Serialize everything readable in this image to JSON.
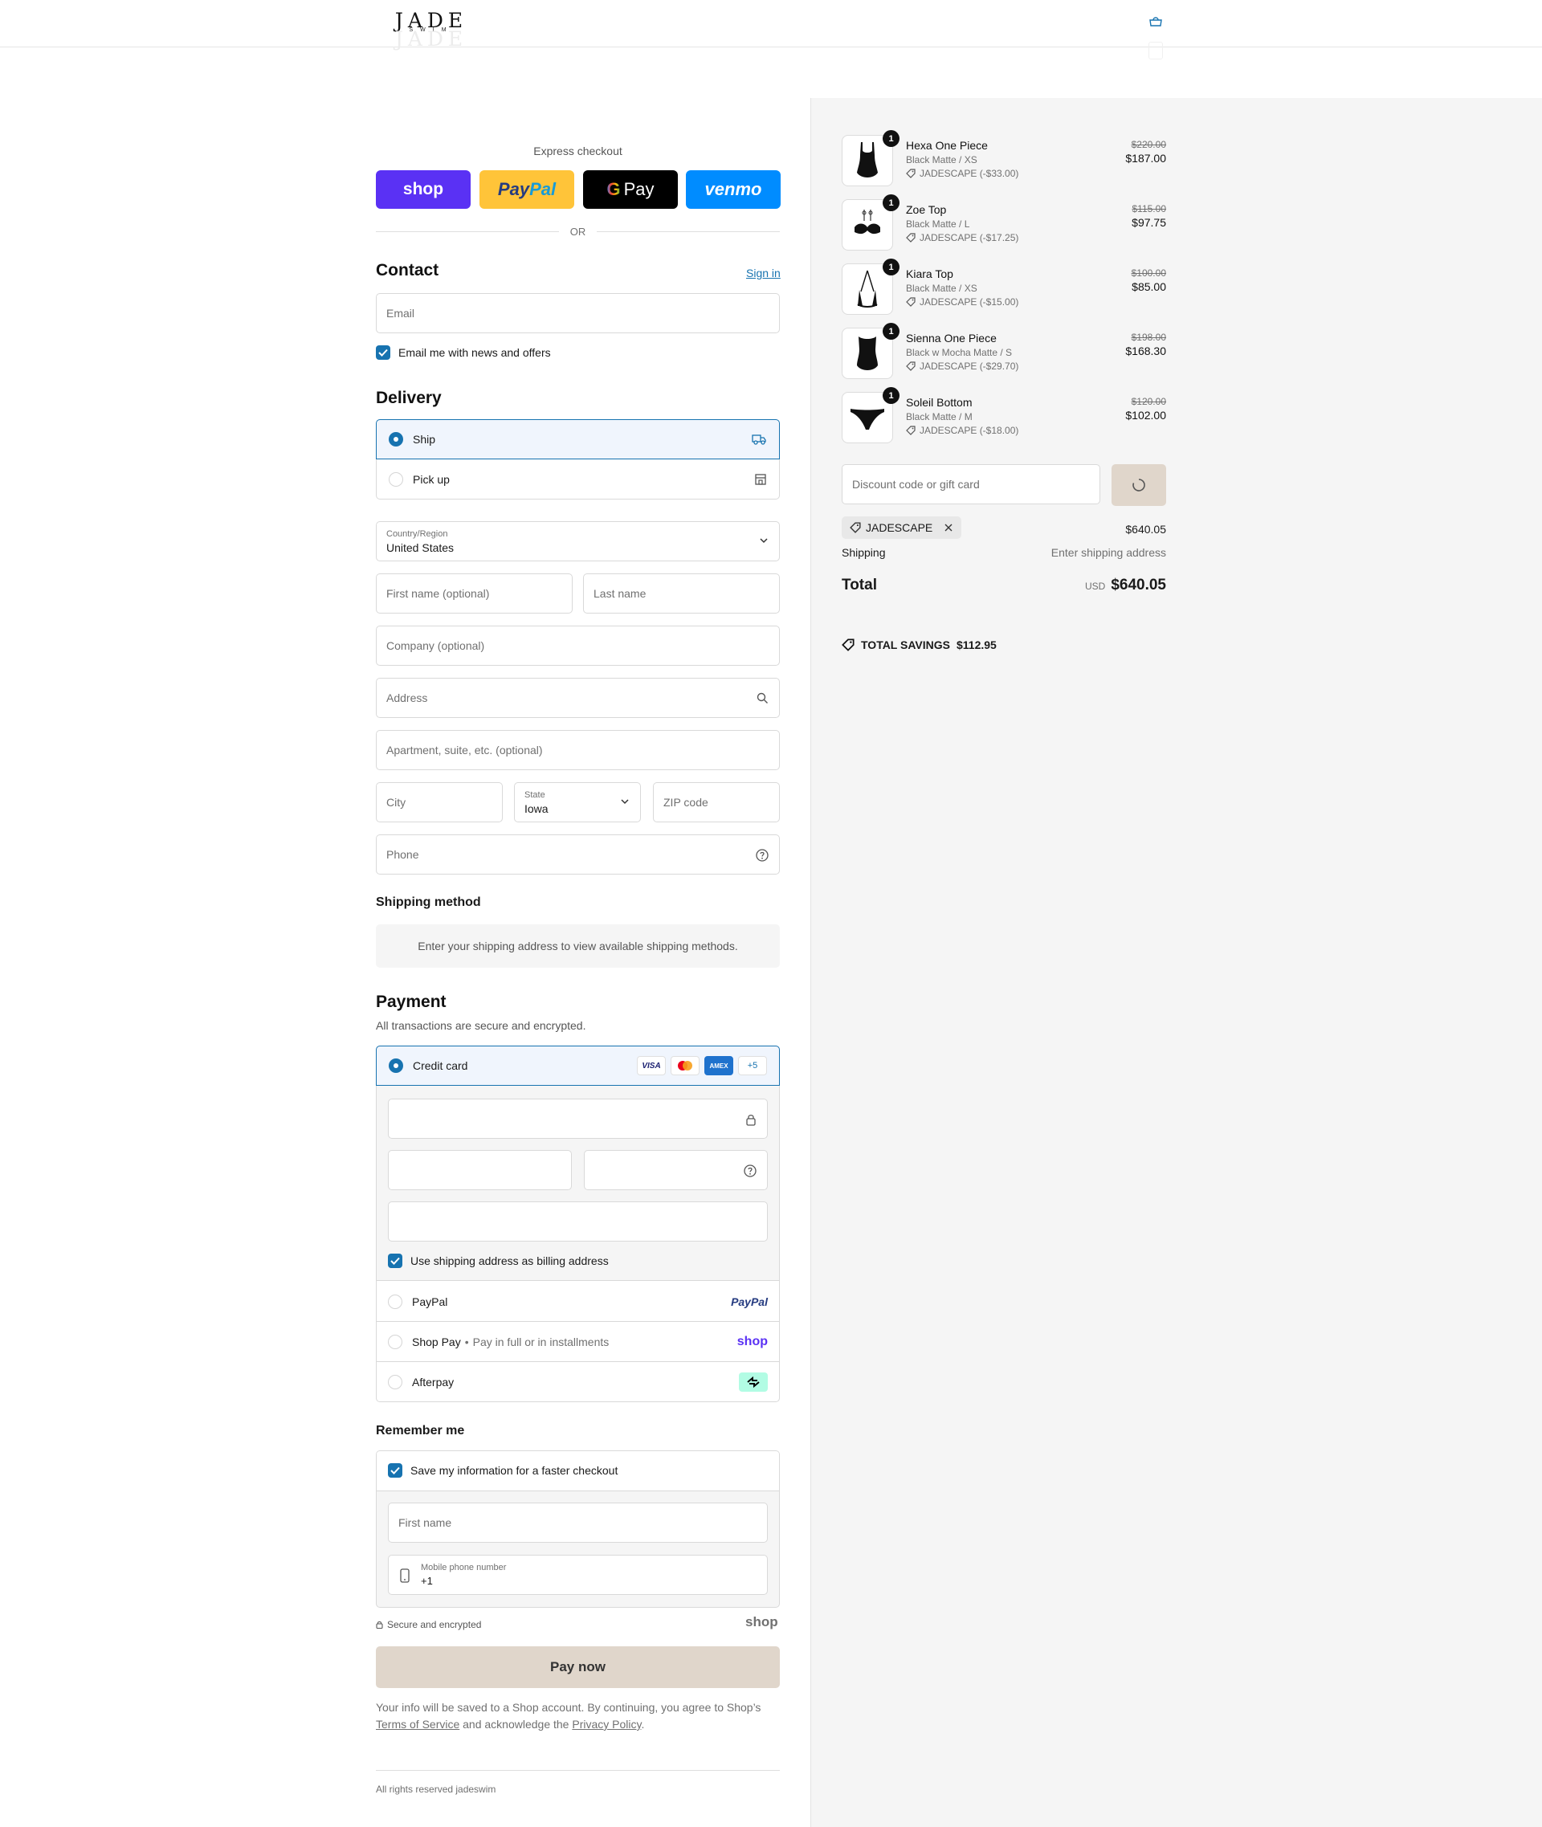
{
  "header": {
    "brand": "JADE",
    "brand_sub": "SWIM"
  },
  "express": {
    "title": "Express checkout",
    "shop_label": "shop",
    "paypal_label_a": "Pay",
    "paypal_label_b": "Pal",
    "gpay_label": "Pay",
    "venmo_label": "venmo",
    "or_label": "OR"
  },
  "contact": {
    "heading": "Contact",
    "sign_in": "Sign in",
    "email_placeholder": "Email",
    "news_label": "Email me with news and offers"
  },
  "delivery": {
    "heading": "Delivery",
    "ship_label": "Ship",
    "pickup_label": "Pick up",
    "country_label": "Country/Region",
    "country_value": "United States",
    "first_name_placeholder": "First name (optional)",
    "last_name_placeholder": "Last name",
    "company_placeholder": "Company (optional)",
    "address_placeholder": "Address",
    "apartment_placeholder": "Apartment, suite, etc. (optional)",
    "city_placeholder": "City",
    "state_label": "State",
    "state_value": "Iowa",
    "zip_placeholder": "ZIP code",
    "phone_placeholder": "Phone"
  },
  "shipping_method": {
    "heading": "Shipping method",
    "notice": "Enter your shipping address to view available shipping methods."
  },
  "payment": {
    "heading": "Payment",
    "subtitle": "All transactions are secure and encrypted.",
    "credit_card_label": "Credit card",
    "card_brands": [
      "VISA",
      "Mastercard",
      "AMEX"
    ],
    "more_brands": "+5",
    "billing_label": "Use shipping address as billing address",
    "paypal_label": "PayPal",
    "paypal_logo": "PayPal",
    "shoppay_label": "Shop Pay",
    "shoppay_sub": "Pay in full or in installments",
    "shoppay_logo": "shop",
    "afterpay_label": "Afterpay"
  },
  "remember": {
    "heading": "Remember me",
    "save_label": "Save my information for a faster checkout",
    "first_name_placeholder": "First name",
    "mobile_label": "Mobile phone number",
    "mobile_value": "+1",
    "secure_label": "Secure and encrypted",
    "shop_logo": "shop"
  },
  "pay_now": "Pay now",
  "legal": {
    "text_a": "Your info will be saved to a Shop account. By continuing, you agree to Shop’s",
    "tos": "Terms of Service",
    "text_b": "and acknowledge the",
    "privacy": "Privacy Policy",
    "text_c": "."
  },
  "footer": "All rights reserved jadeswim",
  "cart": {
    "items": [
      {
        "name": "Hexa One Piece",
        "variant": "Black Matte / XS",
        "discount": "JADESCAPE (-$33.00)",
        "original": "$220.00",
        "price": "$187.00",
        "qty": "1",
        "shape": "one-piece"
      },
      {
        "name": "Zoe Top",
        "variant": "Black Matte / L",
        "discount": "JADESCAPE (-$17.25)",
        "original": "$115.00",
        "price": "$97.75",
        "qty": "1",
        "shape": "top"
      },
      {
        "name": "Kiara Top",
        "variant": "Black Matte / XS",
        "discount": "JADESCAPE (-$15.00)",
        "original": "$100.00",
        "price": "$85.00",
        "qty": "1",
        "shape": "halter"
      },
      {
        "name": "Sienna One Piece",
        "variant": "Black w Mocha Matte / S",
        "discount": "JADESCAPE (-$29.70)",
        "original": "$198.00",
        "price": "$168.30",
        "qty": "1",
        "shape": "one-piece"
      },
      {
        "name": "Soleil Bottom",
        "variant": "Black Matte / M",
        "discount": "JADESCAPE (-$18.00)",
        "original": "$120.00",
        "price": "$102.00",
        "qty": "1",
        "shape": "bottom"
      }
    ],
    "discount_placeholder": "Discount code or gift card",
    "applied_code": "JADESCAPE",
    "subtotal": "$640.05",
    "shipping_label": "Shipping",
    "shipping_value": "Enter shipping address",
    "total_label": "Total",
    "currency": "USD",
    "total": "$640.05",
    "savings_label": "TOTAL SAVINGS",
    "savings_value": "$112.95"
  },
  "colors": {
    "accent": "#1773b0",
    "pay_button": "#e0d6cb",
    "shop_purple": "#5a31f4",
    "paypal_yellow": "#ffc439",
    "venmo_blue": "#008cff",
    "panel_bg": "#f5f5f5"
  }
}
